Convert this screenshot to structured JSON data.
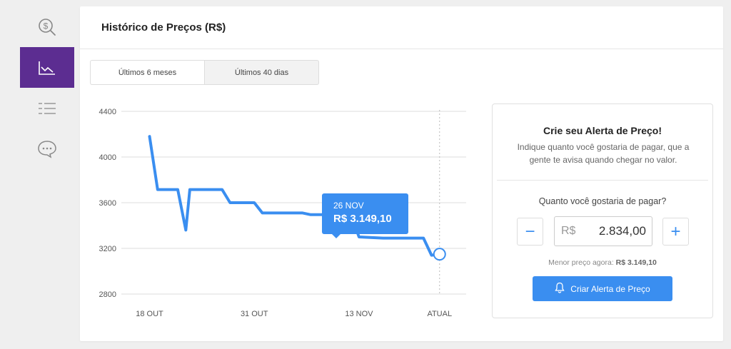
{
  "sidebar": {
    "items": [
      {
        "icon": "price-search-icon",
        "active": false
      },
      {
        "icon": "chart-icon",
        "active": true
      },
      {
        "icon": "list-icon",
        "active": false
      },
      {
        "icon": "chat-icon",
        "active": false
      }
    ]
  },
  "header": {
    "title": "Histórico de Preços (R$)"
  },
  "tabs": [
    {
      "label": "Últimos 6 meses",
      "selected": true
    },
    {
      "label": "Últimos 40 dias",
      "selected": false
    }
  ],
  "chart_data": {
    "type": "line",
    "ylim": [
      2800,
      4400
    ],
    "yticks": [
      "4400",
      "4000",
      "3600",
      "3200",
      "2800"
    ],
    "xtick_labels": [
      "18 OUT",
      "31 OUT",
      "13 NOV",
      "ATUAL"
    ],
    "grid": true,
    "series": [
      {
        "color": "#3a8ef0",
        "points": [
          {
            "day": 18.0,
            "y": 4180
          },
          {
            "day": 19.0,
            "y": 3715
          },
          {
            "day": 21.5,
            "y": 3715
          },
          {
            "day": 22.5,
            "y": 3360
          },
          {
            "day": 23.0,
            "y": 3715
          },
          {
            "day": 27.0,
            "y": 3715
          },
          {
            "day": 28.0,
            "y": 3600
          },
          {
            "day": 31.0,
            "y": 3600
          },
          {
            "day": 32.0,
            "y": 3510
          },
          {
            "day": 37.0,
            "y": 3510
          },
          {
            "day": 38.0,
            "y": 3495
          },
          {
            "day": 43.0,
            "y": 3495
          },
          {
            "day": 44.0,
            "y": 3300
          },
          {
            "day": 47.0,
            "y": 3290
          },
          {
            "day": 52.0,
            "y": 3290
          },
          {
            "day": 53.0,
            "y": 3140
          },
          {
            "day": 54.0,
            "y": 3149.1
          }
        ]
      }
    ],
    "current_marker": {
      "day": 54.0,
      "y": 3149.1
    },
    "tooltip": {
      "date": "26 NOV",
      "price": "R$ 3.149,10"
    }
  },
  "alert": {
    "title": "Crie seu Alerta de Preço!",
    "description": "Indique quanto você gostaria de pagar, que a gente te avisa quando chegar no valor.",
    "question": "Quanto você gostaria de pagar?",
    "minus_label": "−",
    "plus_label": "+",
    "currency_prefix": "R$",
    "input_value": "2.834,00",
    "lowest_label": "Menor preço agora:",
    "lowest_value": "R$ 3.149,10",
    "button_label": "Criar Alerta de Preço",
    "button_icon": "bell-icon"
  },
  "colors": {
    "accent": "#3a8ef0",
    "sidebar_active": "#5c2d91"
  }
}
